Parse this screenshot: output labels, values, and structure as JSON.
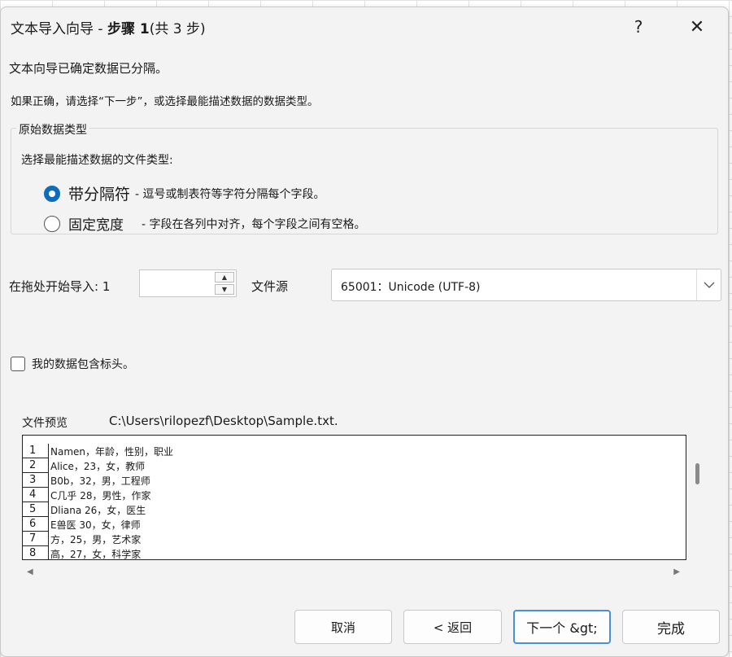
{
  "dialog": {
    "title_prefix": "文本导入向导 - ",
    "title_step": "步骤 1",
    "title_total": "(共 3 步)",
    "help_glyph": "?",
    "close_glyph": "✕"
  },
  "intro": {
    "line1": "文本向导已确定数据已分隔。",
    "line2": "如果正确，请选择“下一步”，或选择最能描述数据的数据类型。"
  },
  "data_type_group": {
    "legend": "原始数据类型",
    "prompt": "选择最能描述数据的文件类型:",
    "options": [
      {
        "label": "带分隔符",
        "description": "- 逗号或制表符等字符分隔每个字段。",
        "selected": true
      },
      {
        "label": "固定宽度",
        "description": "- 字段在各列中对齐，每个字段之间有空格。",
        "selected": false
      }
    ]
  },
  "import_start": {
    "label": "在拖处开始导入:",
    "value": "1"
  },
  "file_origin": {
    "label": "文件源",
    "value": "65001：Unicode (UTF-8)"
  },
  "headers_checkbox": {
    "label": "我的数据包含标头。",
    "checked": false
  },
  "preview": {
    "label": "文件预览",
    "path": "C:\\Users\\rilopezf\\Desktop\\Sample.txt.",
    "rows": [
      {
        "num": "1",
        "text": "Namen，年龄，性别，职业"
      },
      {
        "num": "2",
        "text": "Alice，23，女，教师"
      },
      {
        "num": "3",
        "text": "B0b，32，男，工程师"
      },
      {
        "num": "4",
        "text": "C几乎 28，男性，作家"
      },
      {
        "num": "5",
        "text": "Dliana 26，女，医生"
      },
      {
        "num": "6",
        "text": "E兽医 30，女，律师"
      },
      {
        "num": "7",
        "text": "方，25，男，艺术家"
      },
      {
        "num": "8",
        "text": "高，27，女，科学家"
      }
    ]
  },
  "buttons": {
    "cancel": "取消",
    "back": "< 返回",
    "next": "下一个 &gt;",
    "finish": "完成"
  },
  "colors": {
    "accent": "#0f6cbd",
    "dialog_bg": "#f3f3f3"
  }
}
